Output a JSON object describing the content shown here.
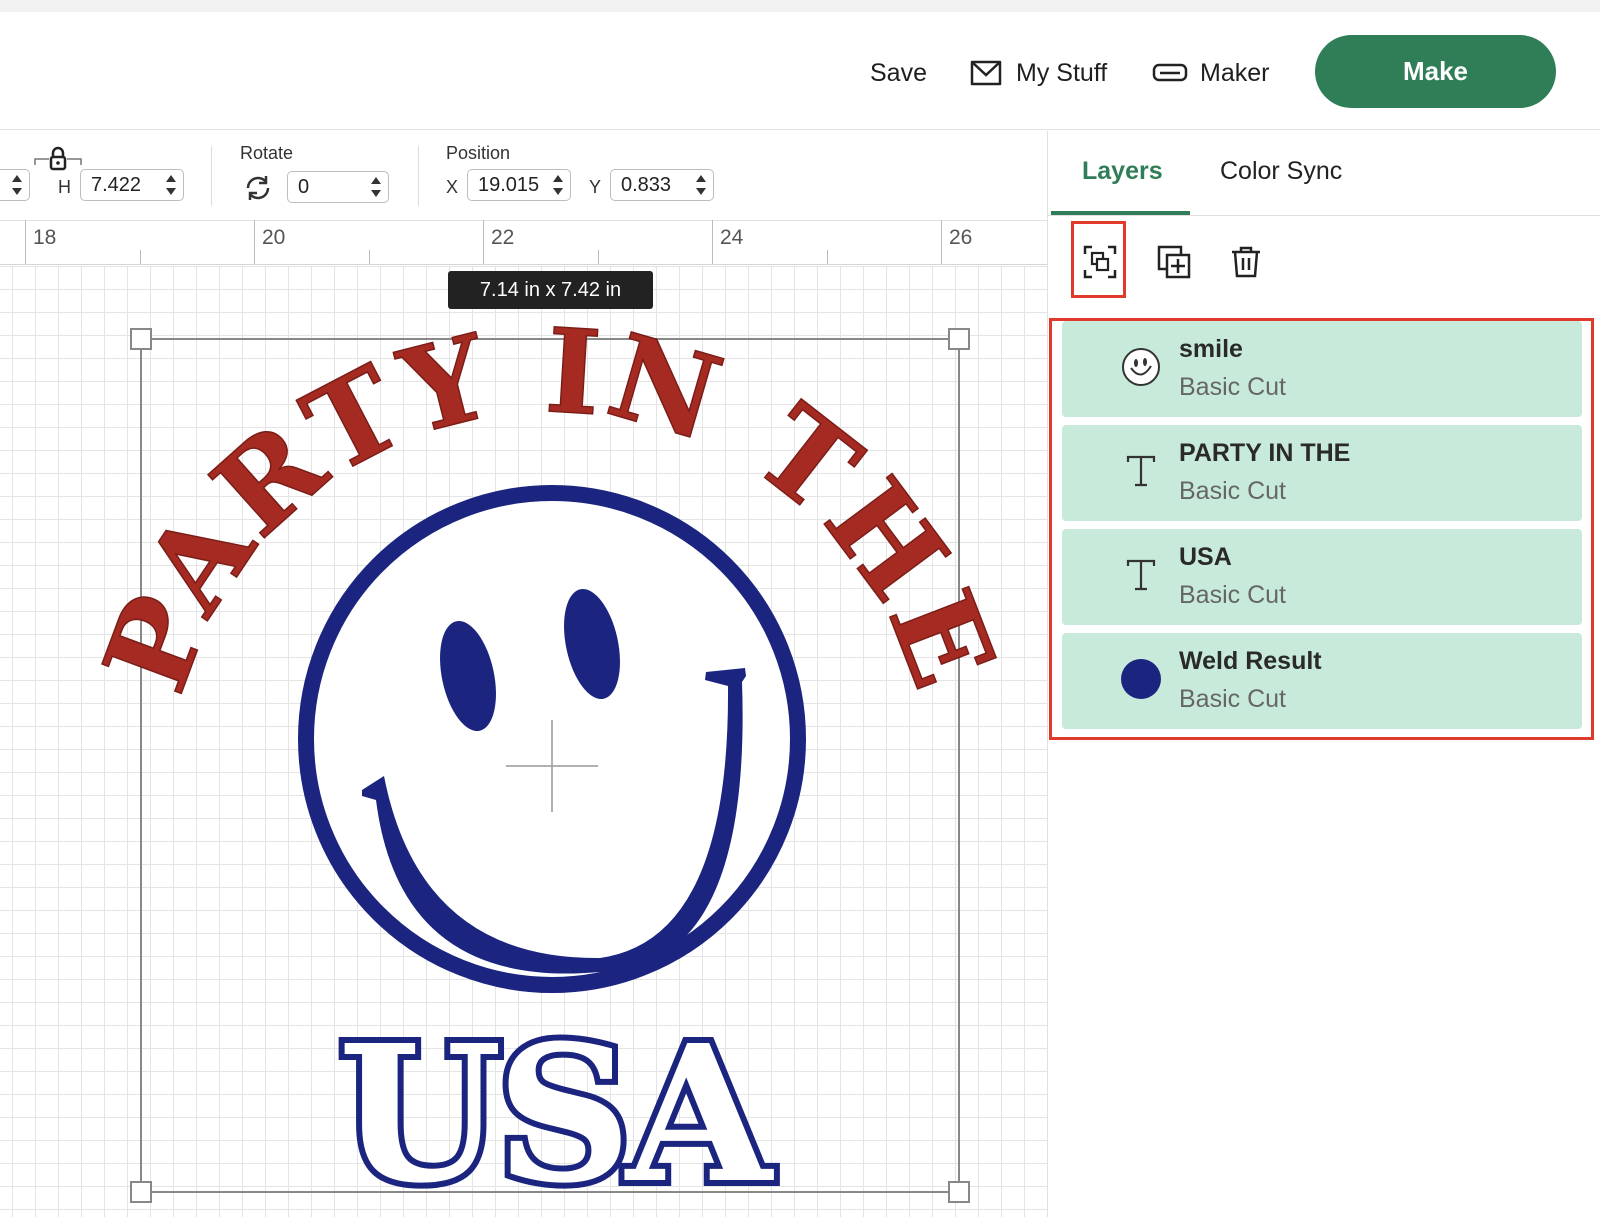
{
  "header": {
    "save_label": "Save",
    "mystuff_label": "My Stuff",
    "maker_label": "Maker",
    "make_label": "Make"
  },
  "toolbar": {
    "height_label": "H",
    "height_value": "7.422",
    "rotate_label": "Rotate",
    "rotate_value": "0",
    "position_label": "Position",
    "x_label": "X",
    "x_value": "19.015",
    "y_label": "Y",
    "y_value": "0.833"
  },
  "ruler": {
    "numbers": [
      "18",
      "20",
      "22",
      "24",
      "26"
    ]
  },
  "canvas": {
    "size_tag": "7.14  in x 7.42  in",
    "design_text_top": "PARTY IN THE",
    "design_text_bottom": "USA",
    "text_red": "#a52a22",
    "navy": "#1b2580"
  },
  "panel": {
    "tabs": [
      {
        "label": "Layers"
      },
      {
        "label": "Color Sync"
      }
    ],
    "layers": [
      {
        "name": "smile",
        "operation": "Basic Cut",
        "icon": "smiley-icon"
      },
      {
        "name": "PARTY IN THE",
        "operation": "Basic Cut",
        "icon": "text-icon"
      },
      {
        "name": "USA",
        "operation": "Basic Cut",
        "icon": "text-icon"
      },
      {
        "name": "Weld Result",
        "operation": "Basic Cut",
        "icon": "circle-icon"
      }
    ]
  },
  "colors": {
    "accent": "#2f7e57",
    "layer_bg": "#c8eadb",
    "highlight": "#e03a2c"
  }
}
